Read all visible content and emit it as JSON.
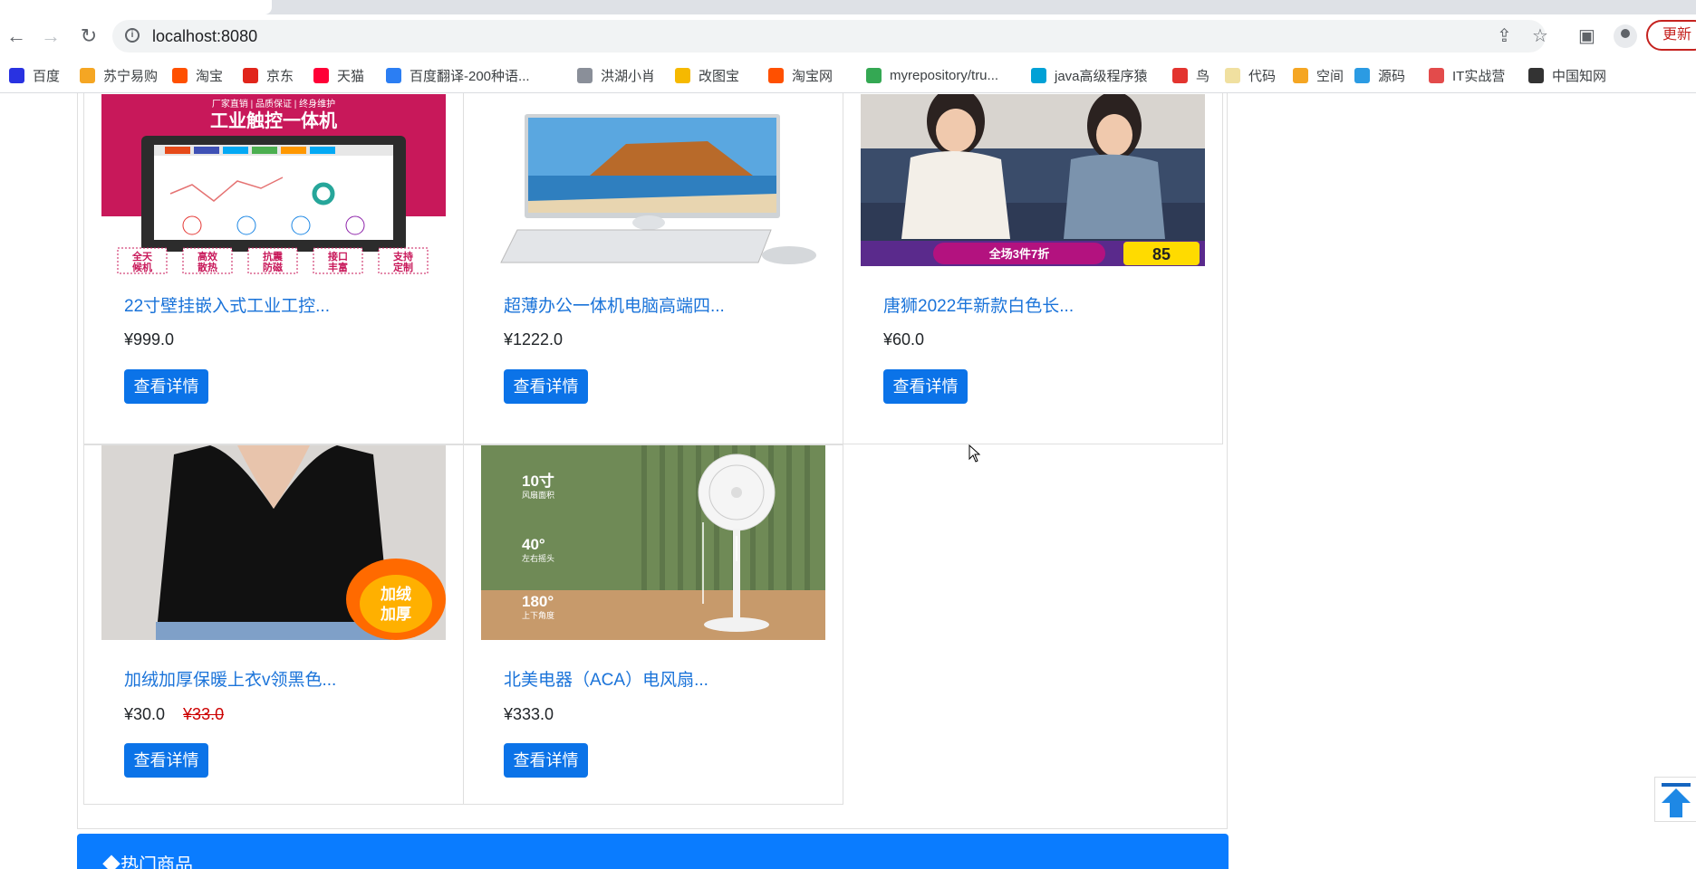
{
  "browser": {
    "url": "localhost:8080",
    "update_label": "更新",
    "bookmarks": [
      {
        "label": "百度",
        "icon": "baidu-icon",
        "color": "#2932e1"
      },
      {
        "label": "苏宁易购",
        "icon": "suning-icon",
        "color": "#f5a623"
      },
      {
        "label": "淘宝",
        "icon": "taobao-icon",
        "color": "#ff5000"
      },
      {
        "label": "京东",
        "icon": "jd-icon",
        "color": "#e1251b"
      },
      {
        "label": "天猫",
        "icon": "tmall-icon",
        "color": "#ff0036"
      },
      {
        "label": "百度翻译-200种语...",
        "icon": "baidu-translate-icon",
        "color": "#2b7ef3"
      },
      {
        "label": "洪湖小肖",
        "icon": "feather-icon",
        "color": "#8a8f99"
      },
      {
        "label": "改图宝",
        "icon": "gaitubao-icon",
        "color": "#f6b900"
      },
      {
        "label": "淘宝网",
        "icon": "taobao-net-icon",
        "color": "#ff5000"
      },
      {
        "label": "myrepository/tru...",
        "icon": "chrome-icon",
        "color": "#34a853"
      },
      {
        "label": "java高级程序猿",
        "icon": "bilibili-icon",
        "color": "#00a1d6"
      },
      {
        "label": "鸟",
        "icon": "bird-icon",
        "color": "#e3342f"
      },
      {
        "label": "代码",
        "icon": "code-icon",
        "color": "#f0e0a0"
      },
      {
        "label": "空间",
        "icon": "qzone-icon",
        "color": "#f5a623"
      },
      {
        "label": "源码",
        "icon": "source-icon",
        "color": "#2b9be3"
      },
      {
        "label": "IT实战营",
        "icon": "it-camp-icon",
        "color": "#e34b4b"
      },
      {
        "label": "中国知网",
        "icon": "cnki-icon",
        "color": "#333333"
      }
    ]
  },
  "products": [
    {
      "title": "22寸壁挂嵌入式工业工控...",
      "price": "¥999.0",
      "old_price": "",
      "button": "查看详情",
      "banner": "工业触控一体机",
      "banner_sub": "厂家直销 | 品质保证 | 终身维护",
      "tags": [
        "全天候机",
        "高效散热",
        "抗震防磁",
        "接口丰富",
        "支持定制"
      ]
    },
    {
      "title": "超薄办公一体机电脑高端四...",
      "price": "¥1222.0",
      "old_price": "",
      "button": "查看详情"
    },
    {
      "title": "唐狮2022年新款白色长...",
      "price": "¥60.0",
      "old_price": "",
      "button": "查看详情",
      "promo": "全场3件7折",
      "promo_num": "85"
    },
    {
      "title": "加绒加厚保暖上衣v领黑色...",
      "price": "¥30.0",
      "old_price": "¥33.0",
      "button": "查看详情",
      "badge": "加绒加厚"
    },
    {
      "title": "北美电器（ACA）电风扇...",
      "price": "¥333.0",
      "old_price": "",
      "button": "查看详情",
      "specs": [
        "10寸",
        "风扇面积",
        "40°",
        "左右摇头",
        "180°",
        "上下角度"
      ]
    }
  ],
  "hot_section": {
    "title": "◆热门商品"
  }
}
